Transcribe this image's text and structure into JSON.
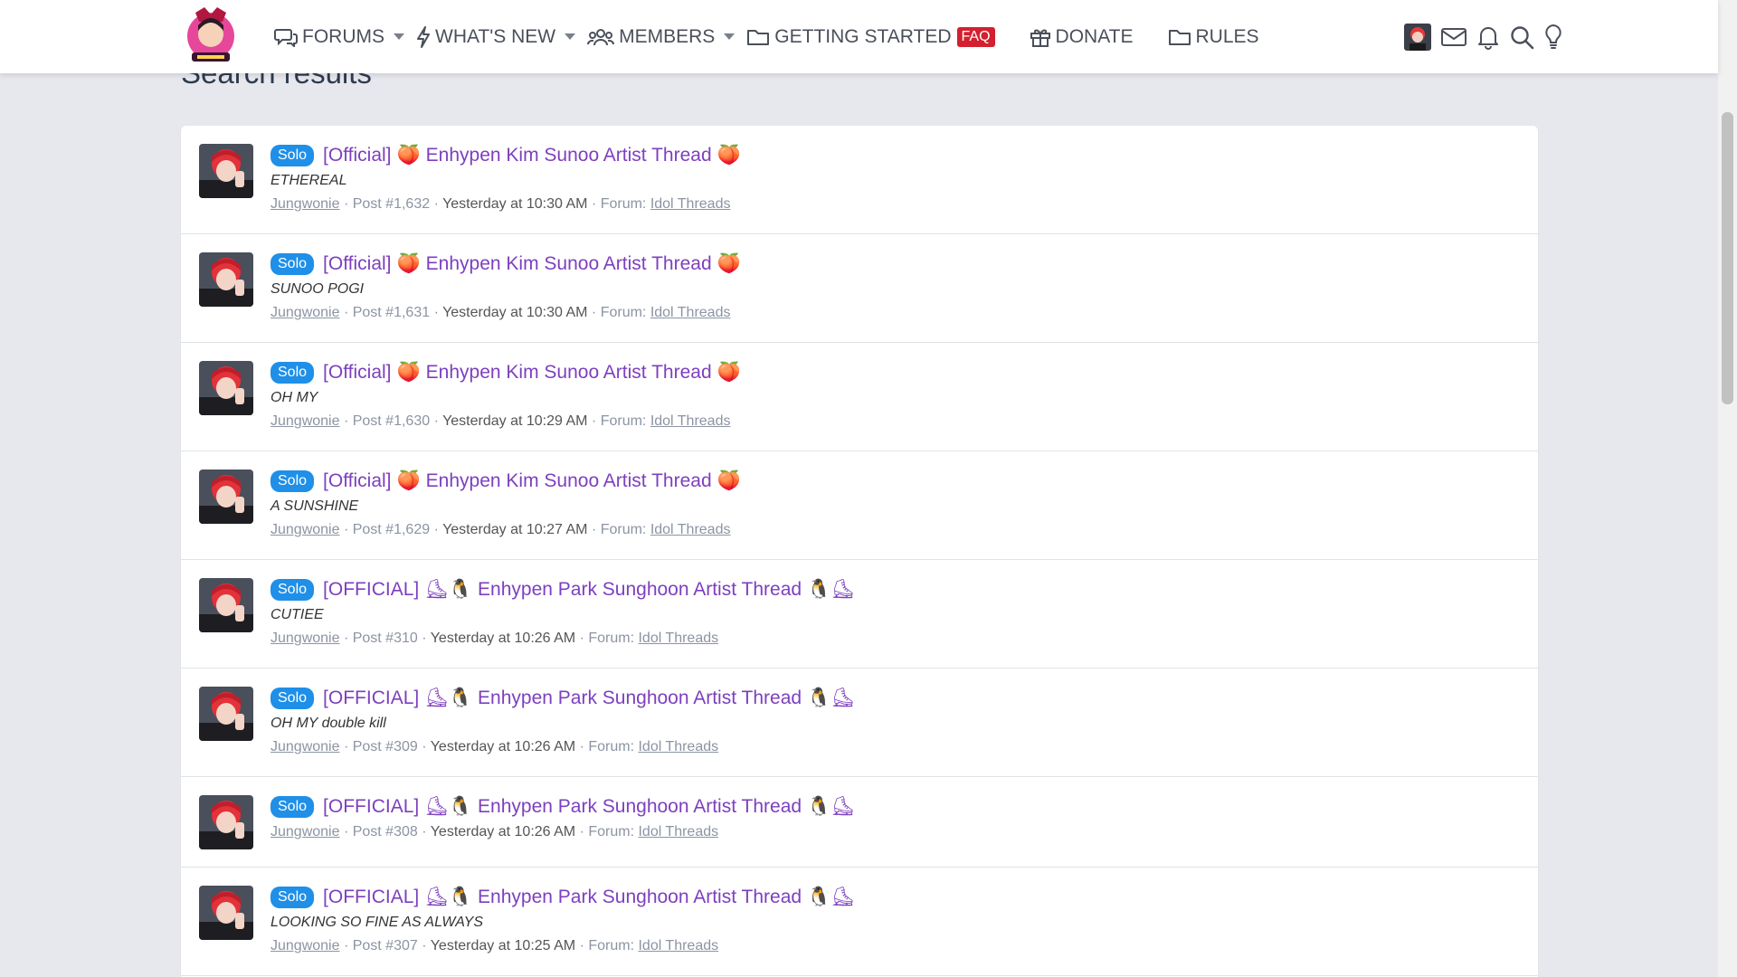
{
  "nav": {
    "forums": "FORUMS",
    "whats_new": "WHAT'S NEW",
    "members": "MEMBERS",
    "getting_started": "GETTING STARTED",
    "faq": "FAQ",
    "donate": "DONATE",
    "rules": "RULES"
  },
  "page": {
    "title": "Search results"
  },
  "results": [
    {
      "badge": "Solo",
      "prefix": "[Official]",
      "emoji_left": "🍑",
      "thread": "Enhypen Kim Sunoo Artist Thread",
      "emoji_right": "🍑",
      "snippet": "ETHEREAL",
      "user": "Jungwonie",
      "post": "Post #1,632",
      "time": "Yesterday at 10:30 AM",
      "forum_label": "Forum:",
      "forum": "Idol Threads"
    },
    {
      "badge": "Solo",
      "prefix": "[Official]",
      "emoji_left": "🍑",
      "thread": "Enhypen Kim Sunoo Artist Thread",
      "emoji_right": "🍑",
      "snippet": "SUNOO POGI",
      "user": "Jungwonie",
      "post": "Post #1,631",
      "time": "Yesterday at 10:30 AM",
      "forum_label": "Forum:",
      "forum": "Idol Threads"
    },
    {
      "badge": "Solo",
      "prefix": "[Official]",
      "emoji_left": "🍑",
      "thread": "Enhypen Kim Sunoo Artist Thread",
      "emoji_right": "🍑",
      "snippet": "OH MY",
      "user": "Jungwonie",
      "post": "Post #1,630",
      "time": "Yesterday at 10:29 AM",
      "forum_label": "Forum:",
      "forum": "Idol Threads"
    },
    {
      "badge": "Solo",
      "prefix": "[Official]",
      "emoji_left": "🍑",
      "thread": "Enhypen Kim Sunoo Artist Thread",
      "emoji_right": "🍑",
      "snippet": "A SUNSHINE",
      "user": "Jungwonie",
      "post": "Post #1,629",
      "time": "Yesterday at 10:27 AM",
      "forum_label": "Forum:",
      "forum": "Idol Threads"
    },
    {
      "badge": "Solo",
      "prefix": "[OFFICIAL]",
      "emoji_left": "⛸🐧",
      "thread": "Enhypen Park Sunghoon Artist Thread",
      "emoji_right": "🐧⛸",
      "snippet": "CUTIEE",
      "user": "Jungwonie",
      "post": "Post #310",
      "time": "Yesterday at 10:26 AM",
      "forum_label": "Forum:",
      "forum": "Idol Threads"
    },
    {
      "badge": "Solo",
      "prefix": "[OFFICIAL]",
      "emoji_left": "⛸🐧",
      "thread": "Enhypen Park Sunghoon Artist Thread",
      "emoji_right": "🐧⛸",
      "snippet": "OH MY double kill",
      "user": "Jungwonie",
      "post": "Post #309",
      "time": "Yesterday at 10:26 AM",
      "forum_label": "Forum:",
      "forum": "Idol Threads"
    },
    {
      "badge": "Solo",
      "prefix": "[OFFICIAL]",
      "emoji_left": "⛸🐧",
      "thread": "Enhypen Park Sunghoon Artist Thread",
      "emoji_right": "🐧⛸",
      "snippet": "",
      "user": "Jungwonie",
      "post": "Post #308",
      "time": "Yesterday at 10:26 AM",
      "forum_label": "Forum:",
      "forum": "Idol Threads"
    },
    {
      "badge": "Solo",
      "prefix": "[OFFICIAL]",
      "emoji_left": "⛸🐧",
      "thread": "Enhypen Park Sunghoon Artist Thread",
      "emoji_right": "🐧⛸",
      "snippet": "LOOKING SO FINE AS ALWAYS",
      "user": "Jungwonie",
      "post": "Post #307",
      "time": "Yesterday at 10:25 AM",
      "forum_label": "Forum:",
      "forum": "Idol Threads"
    }
  ],
  "colors": {
    "accent": "#7d3fbf",
    "badge": "#1f8fe8",
    "faq": "#d3202f"
  }
}
